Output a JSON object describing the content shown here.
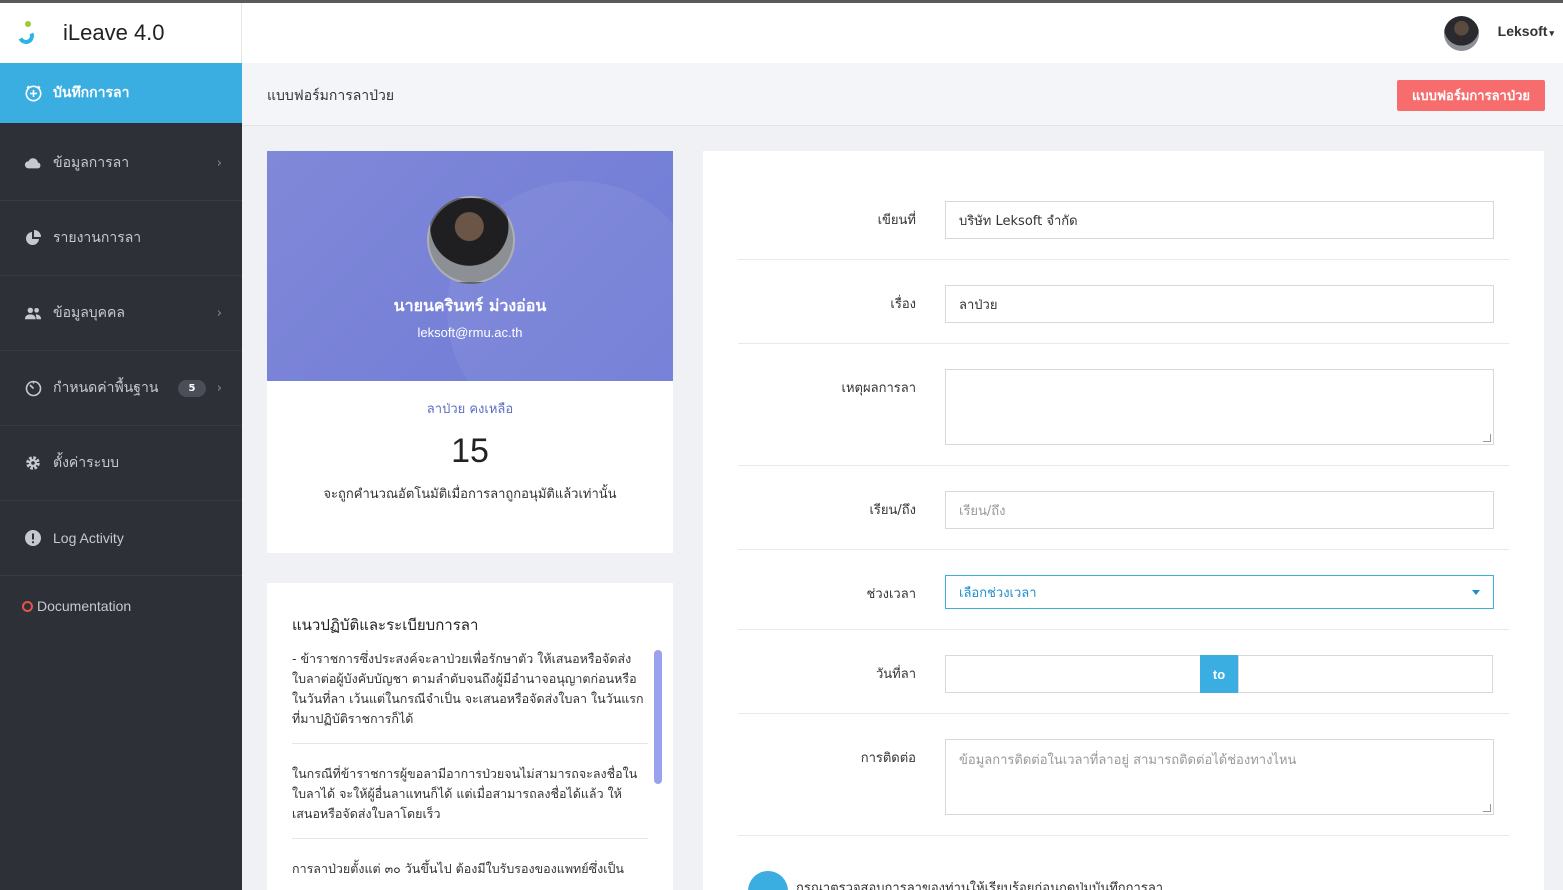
{
  "app": {
    "title": "iLeave 4.0"
  },
  "header": {
    "user_name": "Leksoft"
  },
  "sidebar": {
    "items": [
      {
        "label": "บันทึกการลา",
        "icon": "plus-circle-icon"
      },
      {
        "label": "ข้อมูลการลา",
        "icon": "cloud-icon"
      },
      {
        "label": "รายงานการลา",
        "icon": "pie-chart-icon"
      },
      {
        "label": "ข้อมูลบุคคล",
        "icon": "people-icon"
      },
      {
        "label": "กำหนดค่าพื้นฐาน",
        "icon": "timer-icon",
        "badge": "5"
      },
      {
        "label": "ตั้งค่าระบบ",
        "icon": "gear-icon"
      },
      {
        "label": "Log Activity",
        "icon": "alert-badge-icon"
      },
      {
        "label": "Documentation",
        "icon": "ring-icon"
      }
    ]
  },
  "pagebar": {
    "title": "แบบฟอร์มการลาป่วย",
    "button_label": "แบบฟอร์มการลาป่วย"
  },
  "profile": {
    "name": "นายนครินทร์ ม่วงอ่อน",
    "email": "leksoft@rmu.ac.th",
    "stat_label": "ลาป่วย คงเหลือ",
    "stat_value": "15",
    "stat_note": "จะถูกคำนวณอัตโนมัติเมื่อการลาถูกอนุมัติแล้วเท่านั้น"
  },
  "guide": {
    "title": "แนวปฏิบัติและระเบียบการลา",
    "items": [
      "- ข้าราชการซึ่งประสงค์จะลาป่วยเพื่อรักษาตัว ให้เสนอหรือจัดส่งใบลาต่อผู้บังคับบัญชา ตามลำดับจนถึงผู้มีอำนาจอนุญาตก่อนหรือในวันที่ลา เว้นแต่ในกรณีจำเป็น จะเสนอหรือจัดส่งใบลา ในวันแรกที่มาปฏิบัติราชการก็ได้",
      "ในกรณีที่ข้าราชการผู้ขอลามีอาการป่วยจนไม่สามารถจะลงชื่อในใบลาได้ จะให้ผู้อื่นลาแทนก็ได้ แต่เมื่อสามารถลงชื่อได้แล้ว ให้เสนอหรือจัดส่งใบลาโดยเร็ว",
      "การลาป่วยตั้งแต่ ๓๐ วันขึ้นไป ต้องมีใบรับรองของแพทย์ซึ่งเป็น"
    ]
  },
  "form": {
    "written_at": {
      "label": "เขียนที่",
      "value": "บริษัท Leksoft จำกัด"
    },
    "subject": {
      "label": "เรื่อง",
      "value": "ลาป่วย"
    },
    "reason": {
      "label": "เหตุผลการลา",
      "value": ""
    },
    "to": {
      "label": "เรียน/ถึง",
      "placeholder": "เรียน/ถึง"
    },
    "period": {
      "label": "ช่วงเวลา",
      "value": "เลือกช่วงเวลา"
    },
    "date": {
      "label": "วันที่ลา",
      "to_label": "to"
    },
    "contact": {
      "label": "การติดต่อ",
      "placeholder": "ข้อมูลการติดต่อในเวลาที่ลาอยู่ สามารถติดต่อได้ช่องทางไหน"
    },
    "bottom_note": "กรุณาตรวจสอบการลาของท่านให้เรียบร้อยก่อนกดปุ่มบันทึกการลา"
  }
}
